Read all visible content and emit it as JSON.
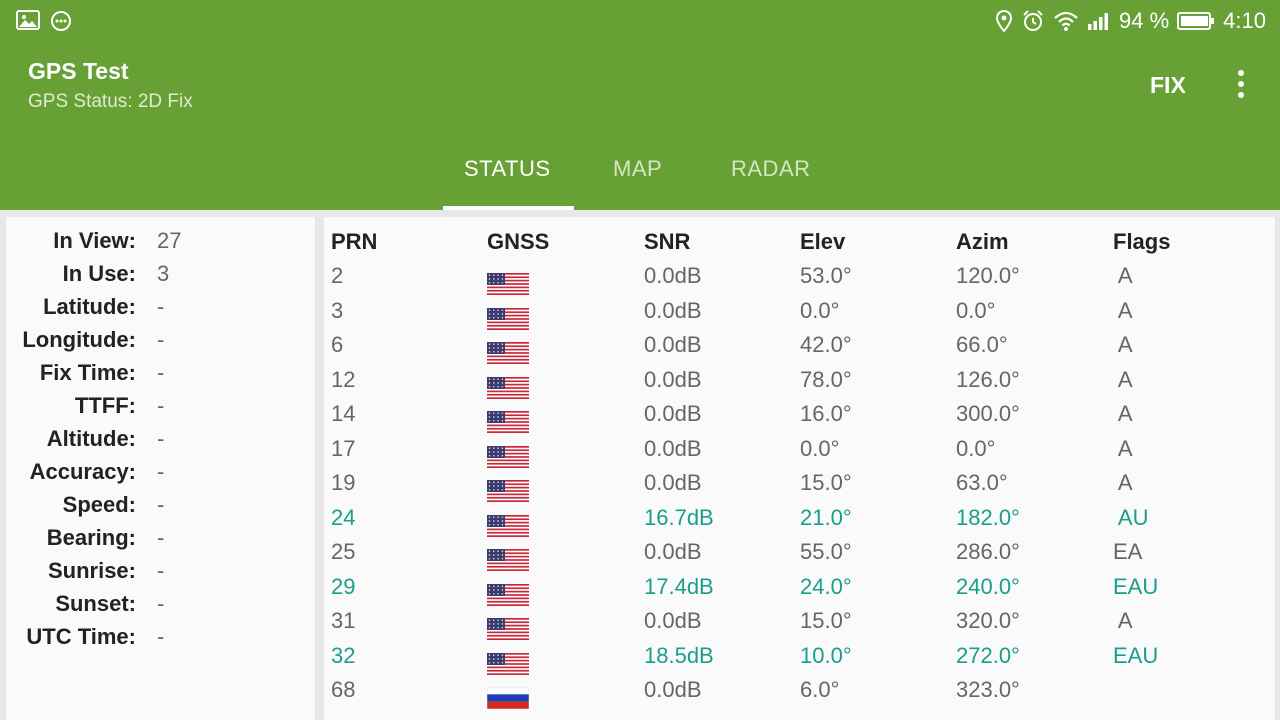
{
  "statusbar": {
    "battery": "94 %",
    "time": "4:10",
    "icons": [
      "image-icon",
      "chat-icon",
      "location-icon",
      "alarm-icon",
      "wifi-icon",
      "signal-icon",
      "battery-icon"
    ]
  },
  "appbar": {
    "title": "GPS Test",
    "subtitle": "GPS Status: 2D Fix",
    "fix_label": "FIX",
    "color": "#67a136"
  },
  "tabs": [
    {
      "label": "STATUS",
      "active": true
    },
    {
      "label": "MAP",
      "active": false
    },
    {
      "label": "RADAR",
      "active": false
    }
  ],
  "status": [
    {
      "label": "In View:",
      "value": "27"
    },
    {
      "label": "In Use:",
      "value": "3"
    },
    {
      "label": "Latitude:",
      "value": "-"
    },
    {
      "label": "Longitude:",
      "value": "-"
    },
    {
      "label": "Fix Time:",
      "value": "-"
    },
    {
      "label": "TTFF:",
      "value": "-"
    },
    {
      "label": "Altitude:",
      "value": "-"
    },
    {
      "label": "Accuracy:",
      "value": "-"
    },
    {
      "label": "Speed:",
      "value": "-"
    },
    {
      "label": "Bearing:",
      "value": "-"
    },
    {
      "label": "Sunrise:",
      "value": "-"
    },
    {
      "label": "Sunset:",
      "value": "-"
    },
    {
      "label": "UTC Time:",
      "value": "-"
    }
  ],
  "table": {
    "headers": [
      "PRN",
      "GNSS",
      "SNR",
      "Elev",
      "Azim",
      "Flags"
    ],
    "used_color": "#1a9e8c",
    "rows": [
      {
        "prn": "2",
        "gnss": "us",
        "snr": "0.0dB",
        "elev": "53.0°",
        "azim": "120.0°",
        "flags": " A",
        "used": false
      },
      {
        "prn": "3",
        "gnss": "us",
        "snr": "0.0dB",
        "elev": "0.0°",
        "azim": "0.0°",
        "flags": " A",
        "used": false
      },
      {
        "prn": "6",
        "gnss": "us",
        "snr": "0.0dB",
        "elev": "42.0°",
        "azim": "66.0°",
        "flags": " A",
        "used": false
      },
      {
        "prn": "12",
        "gnss": "us",
        "snr": "0.0dB",
        "elev": "78.0°",
        "azim": "126.0°",
        "flags": " A",
        "used": false
      },
      {
        "prn": "14",
        "gnss": "us",
        "snr": "0.0dB",
        "elev": "16.0°",
        "azim": "300.0°",
        "flags": " A",
        "used": false
      },
      {
        "prn": "17",
        "gnss": "us",
        "snr": "0.0dB",
        "elev": "0.0°",
        "azim": "0.0°",
        "flags": " A",
        "used": false
      },
      {
        "prn": "19",
        "gnss": "us",
        "snr": "0.0dB",
        "elev": "15.0°",
        "azim": "63.0°",
        "flags": " A",
        "used": false
      },
      {
        "prn": "24",
        "gnss": "us",
        "snr": "16.7dB",
        "elev": "21.0°",
        "azim": "182.0°",
        "flags": " AU",
        "used": true
      },
      {
        "prn": "25",
        "gnss": "us",
        "snr": "0.0dB",
        "elev": "55.0°",
        "azim": "286.0°",
        "flags": "EA",
        "used": false
      },
      {
        "prn": "29",
        "gnss": "us",
        "snr": "17.4dB",
        "elev": "24.0°",
        "azim": "240.0°",
        "flags": "EAU",
        "used": true
      },
      {
        "prn": "31",
        "gnss": "us",
        "snr": "0.0dB",
        "elev": "15.0°",
        "azim": "320.0°",
        "flags": " A",
        "used": false
      },
      {
        "prn": "32",
        "gnss": "us",
        "snr": "18.5dB",
        "elev": "10.0°",
        "azim": "272.0°",
        "flags": "EAU",
        "used": true
      },
      {
        "prn": "68",
        "gnss": "ru",
        "snr": "0.0dB",
        "elev": "6.0°",
        "azim": "323.0°",
        "flags": "",
        "used": false
      }
    ]
  }
}
